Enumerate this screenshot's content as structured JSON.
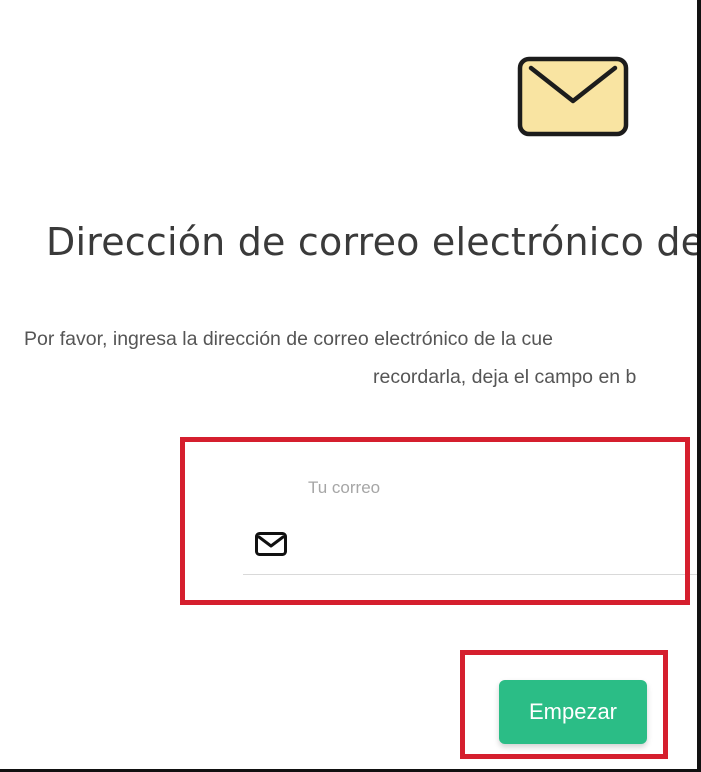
{
  "header": {
    "hero_icon": "envelope-icon",
    "title": "Dirección de correo electrónico de"
  },
  "description": {
    "line1": "Por favor, ingresa la dirección de correo electrónico de la cue",
    "line2": "recordarla, deja el campo en b"
  },
  "email_field": {
    "label": "Tu correo",
    "value": "",
    "icon": "mail-icon"
  },
  "actions": {
    "start_label": "Empezar"
  },
  "colors": {
    "accent_button": "#2bbd86",
    "highlight_box": "#d51f2e",
    "envelope_fill": "#f9e4a2",
    "title_text": "#3a3a3a"
  }
}
